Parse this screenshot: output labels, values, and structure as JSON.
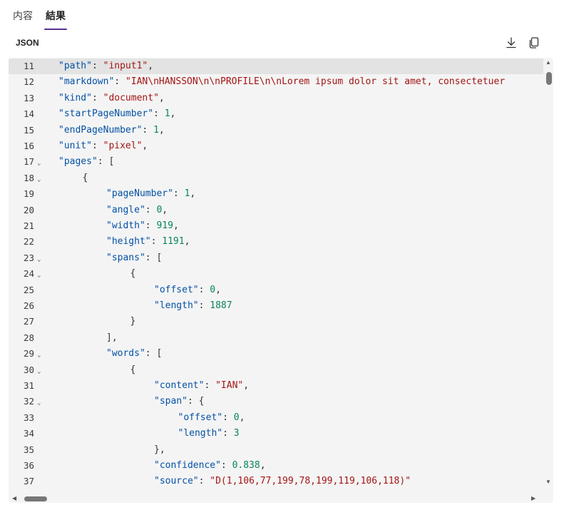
{
  "tabs": [
    {
      "label": "内容",
      "active": false
    },
    {
      "label": "結果",
      "active": true
    }
  ],
  "section": {
    "title": "JSON"
  },
  "toolbar": {
    "download_icon": "download-icon",
    "copy_icon": "copy-icon"
  },
  "editor": {
    "current_line": 11,
    "lines": [
      {
        "no": "11",
        "fold": false,
        "indent": 0,
        "tokens": [
          [
            "k",
            "\"path\""
          ],
          [
            "p",
            ": "
          ],
          [
            "s",
            "\"input1\""
          ],
          [
            "p",
            ","
          ]
        ]
      },
      {
        "no": "12",
        "fold": false,
        "indent": 0,
        "tokens": [
          [
            "k",
            "\"markdown\""
          ],
          [
            "p",
            ": "
          ],
          [
            "s",
            "\"IAN\\nHANSSON\\n\\nPROFILE\\n\\nLorem ipsum dolor sit amet, consectetuer"
          ]
        ]
      },
      {
        "no": "13",
        "fold": false,
        "indent": 0,
        "tokens": [
          [
            "k",
            "\"kind\""
          ],
          [
            "p",
            ": "
          ],
          [
            "s",
            "\"document\""
          ],
          [
            "p",
            ","
          ]
        ]
      },
      {
        "no": "14",
        "fold": false,
        "indent": 0,
        "tokens": [
          [
            "k",
            "\"startPageNumber\""
          ],
          [
            "p",
            ": "
          ],
          [
            "n",
            "1"
          ],
          [
            "p",
            ","
          ]
        ]
      },
      {
        "no": "15",
        "fold": false,
        "indent": 0,
        "tokens": [
          [
            "k",
            "\"endPageNumber\""
          ],
          [
            "p",
            ": "
          ],
          [
            "n",
            "1"
          ],
          [
            "p",
            ","
          ]
        ]
      },
      {
        "no": "16",
        "fold": false,
        "indent": 0,
        "tokens": [
          [
            "k",
            "\"unit\""
          ],
          [
            "p",
            ": "
          ],
          [
            "s",
            "\"pixel\""
          ],
          [
            "p",
            ","
          ]
        ]
      },
      {
        "no": "17",
        "fold": true,
        "indent": 0,
        "tokens": [
          [
            "k",
            "\"pages\""
          ],
          [
            "p",
            ": ["
          ]
        ]
      },
      {
        "no": "18",
        "fold": true,
        "indent": 1,
        "tokens": [
          [
            "p",
            "{"
          ]
        ]
      },
      {
        "no": "19",
        "fold": false,
        "indent": 2,
        "tokens": [
          [
            "k",
            "\"pageNumber\""
          ],
          [
            "p",
            ": "
          ],
          [
            "n",
            "1"
          ],
          [
            "p",
            ","
          ]
        ]
      },
      {
        "no": "20",
        "fold": false,
        "indent": 2,
        "tokens": [
          [
            "k",
            "\"angle\""
          ],
          [
            "p",
            ": "
          ],
          [
            "n",
            "0"
          ],
          [
            "p",
            ","
          ]
        ]
      },
      {
        "no": "21",
        "fold": false,
        "indent": 2,
        "tokens": [
          [
            "k",
            "\"width\""
          ],
          [
            "p",
            ": "
          ],
          [
            "n",
            "919"
          ],
          [
            "p",
            ","
          ]
        ]
      },
      {
        "no": "22",
        "fold": false,
        "indent": 2,
        "tokens": [
          [
            "k",
            "\"height\""
          ],
          [
            "p",
            ": "
          ],
          [
            "n",
            "1191"
          ],
          [
            "p",
            ","
          ]
        ]
      },
      {
        "no": "23",
        "fold": true,
        "indent": 2,
        "tokens": [
          [
            "k",
            "\"spans\""
          ],
          [
            "p",
            ": ["
          ]
        ]
      },
      {
        "no": "24",
        "fold": true,
        "indent": 3,
        "tokens": [
          [
            "p",
            "{"
          ]
        ]
      },
      {
        "no": "25",
        "fold": false,
        "indent": 4,
        "tokens": [
          [
            "k",
            "\"offset\""
          ],
          [
            "p",
            ": "
          ],
          [
            "n",
            "0"
          ],
          [
            "p",
            ","
          ]
        ]
      },
      {
        "no": "26",
        "fold": false,
        "indent": 4,
        "tokens": [
          [
            "k",
            "\"length\""
          ],
          [
            "p",
            ": "
          ],
          [
            "n",
            "1887"
          ]
        ]
      },
      {
        "no": "27",
        "fold": false,
        "indent": 3,
        "tokens": [
          [
            "p",
            "}"
          ]
        ]
      },
      {
        "no": "28",
        "fold": false,
        "indent": 2,
        "tokens": [
          [
            "p",
            "],"
          ]
        ]
      },
      {
        "no": "29",
        "fold": true,
        "indent": 2,
        "tokens": [
          [
            "k",
            "\"words\""
          ],
          [
            "p",
            ": ["
          ]
        ]
      },
      {
        "no": "30",
        "fold": true,
        "indent": 3,
        "tokens": [
          [
            "p",
            "{"
          ]
        ]
      },
      {
        "no": "31",
        "fold": false,
        "indent": 4,
        "tokens": [
          [
            "k",
            "\"content\""
          ],
          [
            "p",
            ": "
          ],
          [
            "s",
            "\"IAN\""
          ],
          [
            "p",
            ","
          ]
        ]
      },
      {
        "no": "32",
        "fold": true,
        "indent": 4,
        "tokens": [
          [
            "k",
            "\"span\""
          ],
          [
            "p",
            ": {"
          ]
        ]
      },
      {
        "no": "33",
        "fold": false,
        "indent": 5,
        "tokens": [
          [
            "k",
            "\"offset\""
          ],
          [
            "p",
            ": "
          ],
          [
            "n",
            "0"
          ],
          [
            "p",
            ","
          ]
        ]
      },
      {
        "no": "34",
        "fold": false,
        "indent": 5,
        "tokens": [
          [
            "k",
            "\"length\""
          ],
          [
            "p",
            ": "
          ],
          [
            "n",
            "3"
          ]
        ]
      },
      {
        "no": "35",
        "fold": false,
        "indent": 4,
        "tokens": [
          [
            "p",
            "},"
          ]
        ]
      },
      {
        "no": "36",
        "fold": false,
        "indent": 4,
        "tokens": [
          [
            "k",
            "\"confidence\""
          ],
          [
            "p",
            ": "
          ],
          [
            "n",
            "0.838"
          ],
          [
            "p",
            ","
          ]
        ]
      },
      {
        "no": "37",
        "fold": false,
        "indent": 4,
        "tokens": [
          [
            "k",
            "\"source\""
          ],
          [
            "p",
            ": "
          ],
          [
            "s",
            "\"D(1,106,77,199,78,199,119,106,118)\""
          ]
        ]
      }
    ]
  },
  "colors": {
    "accent": "#5c2e91",
    "json_key": "#0451a5",
    "json_string": "#a31515",
    "json_number": "#098658"
  }
}
